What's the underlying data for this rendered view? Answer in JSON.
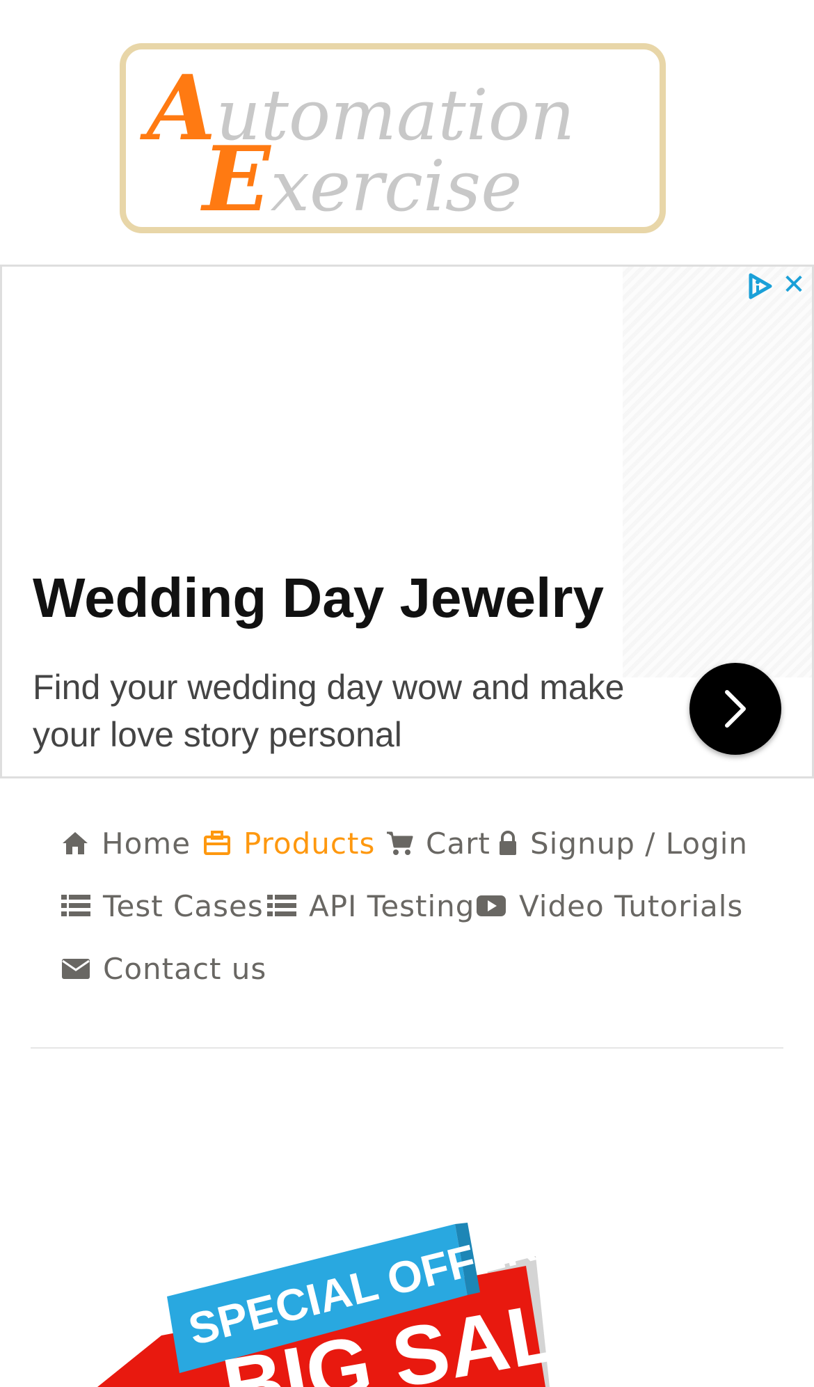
{
  "logo": {
    "line1_cap": "A",
    "line1_rest": "utomation",
    "line2_cap": "E",
    "line2_rest": "xercise",
    "colors": {
      "accent": "#ff7a12",
      "text": "#c8c8c8",
      "border": "#e8d6a8"
    }
  },
  "ad": {
    "headline": "Wedding Day Jewelry",
    "description": "Find your wedding day wow and make your love story personal",
    "close_glyph": "✕",
    "colors": {
      "adchoices": "#1aa0d8",
      "button": "#000000"
    }
  },
  "nav": {
    "items": [
      {
        "label": "Home",
        "icon": "home-icon",
        "active": false
      },
      {
        "label": "Products",
        "icon": "briefcase-icon",
        "active": true
      },
      {
        "label": "Cart",
        "icon": "cart-icon",
        "active": false
      },
      {
        "label": "Signup / Login",
        "icon": "lock-icon",
        "active": false
      },
      {
        "label": "Test Cases",
        "icon": "list-icon",
        "active": false
      },
      {
        "label": "API Testing",
        "icon": "list-icon",
        "active": false
      },
      {
        "label": "Video Tutorials",
        "icon": "youtube-play-icon",
        "active": false
      },
      {
        "label": "Contact us",
        "icon": "envelope-icon",
        "active": false
      }
    ],
    "colors": {
      "default": "#696763",
      "active": "#fe980f"
    }
  },
  "banner": {
    "tag": "SPECIAL OFFER",
    "headline": "BIG SALE",
    "colors": {
      "tag": "#29a8e0",
      "main": "#e8190f"
    }
  }
}
